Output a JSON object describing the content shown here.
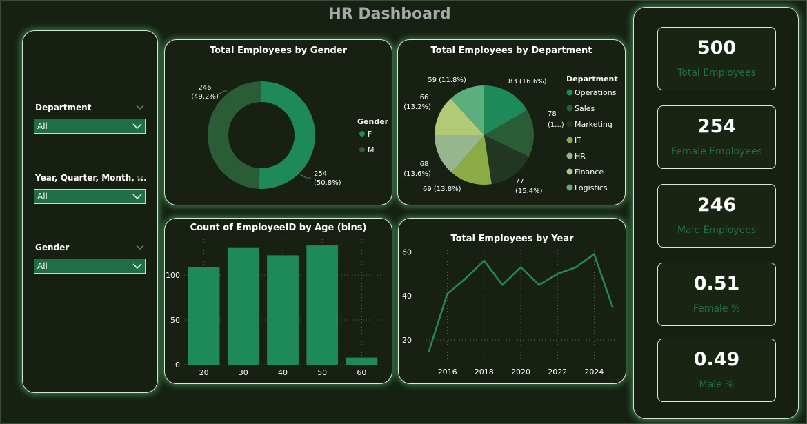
{
  "dashboard_title": "HR Dashboard",
  "slicers": [
    {
      "label": "Department",
      "value": "All"
    },
    {
      "label": "Year, Quarter, Month, ...",
      "value": "All"
    },
    {
      "label": "Gender",
      "value": "All"
    }
  ],
  "kpis": [
    {
      "value": "500",
      "label": "Total Employees"
    },
    {
      "value": "254",
      "label": "Female Employees"
    },
    {
      "value": "246",
      "label": "Male Employees"
    },
    {
      "value": "0.51",
      "label": "Female %"
    },
    {
      "value": "0.49",
      "label": "Male %"
    }
  ],
  "colors": {
    "accent": "#1e8a5a",
    "background": "#162113",
    "border_glow": "#63d282"
  },
  "chart_data": [
    {
      "type": "pie",
      "subtype": "donut",
      "title": "Total Employees by Gender",
      "legend_title": "Gender",
      "legend_position": "right",
      "slices": [
        {
          "label": "F",
          "value": 254,
          "pct_label": "(50.8%)",
          "color": "#1e8a5a"
        },
        {
          "label": "M",
          "value": 246,
          "pct_label": "(49.2%)",
          "color": "#2a5c36"
        }
      ]
    },
    {
      "type": "pie",
      "title": "Total Employees by Department",
      "legend_title": "Department",
      "legend_position": "right",
      "slices": [
        {
          "label": "Operations",
          "value": 83,
          "pct_label": "(16.6%)",
          "color": "#1e8a5a"
        },
        {
          "label": "Sales",
          "value": 78,
          "pct_label": "(1...)",
          "color": "#2a5c36"
        },
        {
          "label": "Marketing",
          "value": 77,
          "pct_label": "(15.4%)",
          "color": "#223721"
        },
        {
          "label": "IT",
          "value": 69,
          "pct_label": "(13.8%)",
          "color": "#8aab45"
        },
        {
          "label": "HR",
          "value": 68,
          "pct_label": "(13.6%)",
          "color": "#96b68e"
        },
        {
          "label": "Finance",
          "value": 66,
          "pct_label": "(13.2%)",
          "color": "#b2c976"
        },
        {
          "label": "Logistics",
          "value": 59,
          "pct_label": "(11.8%)",
          "color": "#5caf7d"
        }
      ]
    },
    {
      "type": "bar",
      "title": "Count of EmployeeID by Age (bins)",
      "categories": [
        "20",
        "30",
        "40",
        "50",
        "60"
      ],
      "values": [
        109,
        131,
        122,
        133,
        8
      ],
      "ylim": [
        0,
        140
      ],
      "yticks": [
        "0",
        "50",
        "100"
      ],
      "grid": true,
      "color": "#1e8a5a"
    },
    {
      "type": "line",
      "title": "Total Employees by Year",
      "x": [
        2015,
        2016,
        2017,
        2018,
        2019,
        2020,
        2021,
        2022,
        2023,
        2024,
        2025
      ],
      "values": [
        15,
        41,
        48,
        56,
        45,
        53,
        45,
        50,
        53,
        59,
        35
      ],
      "xticks": [
        "2016",
        "2018",
        "2020",
        "2022",
        "2024"
      ],
      "yticks": [
        "20",
        "40",
        "60"
      ],
      "ylim": [
        10,
        62
      ],
      "grid": true,
      "color": "#1e8a5a"
    }
  ]
}
